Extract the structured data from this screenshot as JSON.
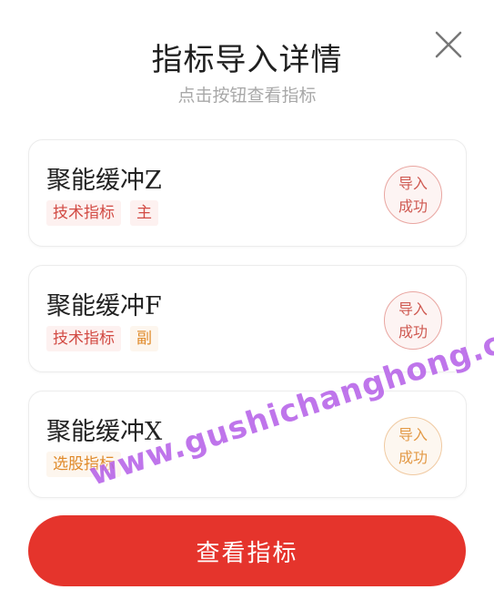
{
  "modal": {
    "title": "指标导入详情",
    "subtitle": "点击按钮查看指标",
    "close_icon": "close-icon"
  },
  "cards": [
    {
      "name": "聚能缓冲Z",
      "tags": [
        "技术指标",
        "主"
      ],
      "tag_colors": [
        "red",
        "red"
      ],
      "stamp_line1": "导入",
      "stamp_line2": "成功",
      "stamp_color": "red"
    },
    {
      "name": "聚能缓冲F",
      "tags": [
        "技术指标",
        "副"
      ],
      "tag_colors": [
        "red",
        "orange"
      ],
      "stamp_line1": "导入",
      "stamp_line2": "成功",
      "stamp_color": "red"
    },
    {
      "name": "聚能缓冲X",
      "tags": [
        "选股指标"
      ],
      "tag_colors": [
        "orange"
      ],
      "stamp_line1": "导入",
      "stamp_line2": "成功",
      "stamp_color": "orange"
    }
  ],
  "button": {
    "label": "查看指标"
  },
  "watermark": "www.gushichanghong.com",
  "colors": {
    "accent": "#e5342c",
    "tag_red": "#d24a43",
    "tag_orange": "#e08a2a",
    "watermark": "#b45ee8"
  }
}
